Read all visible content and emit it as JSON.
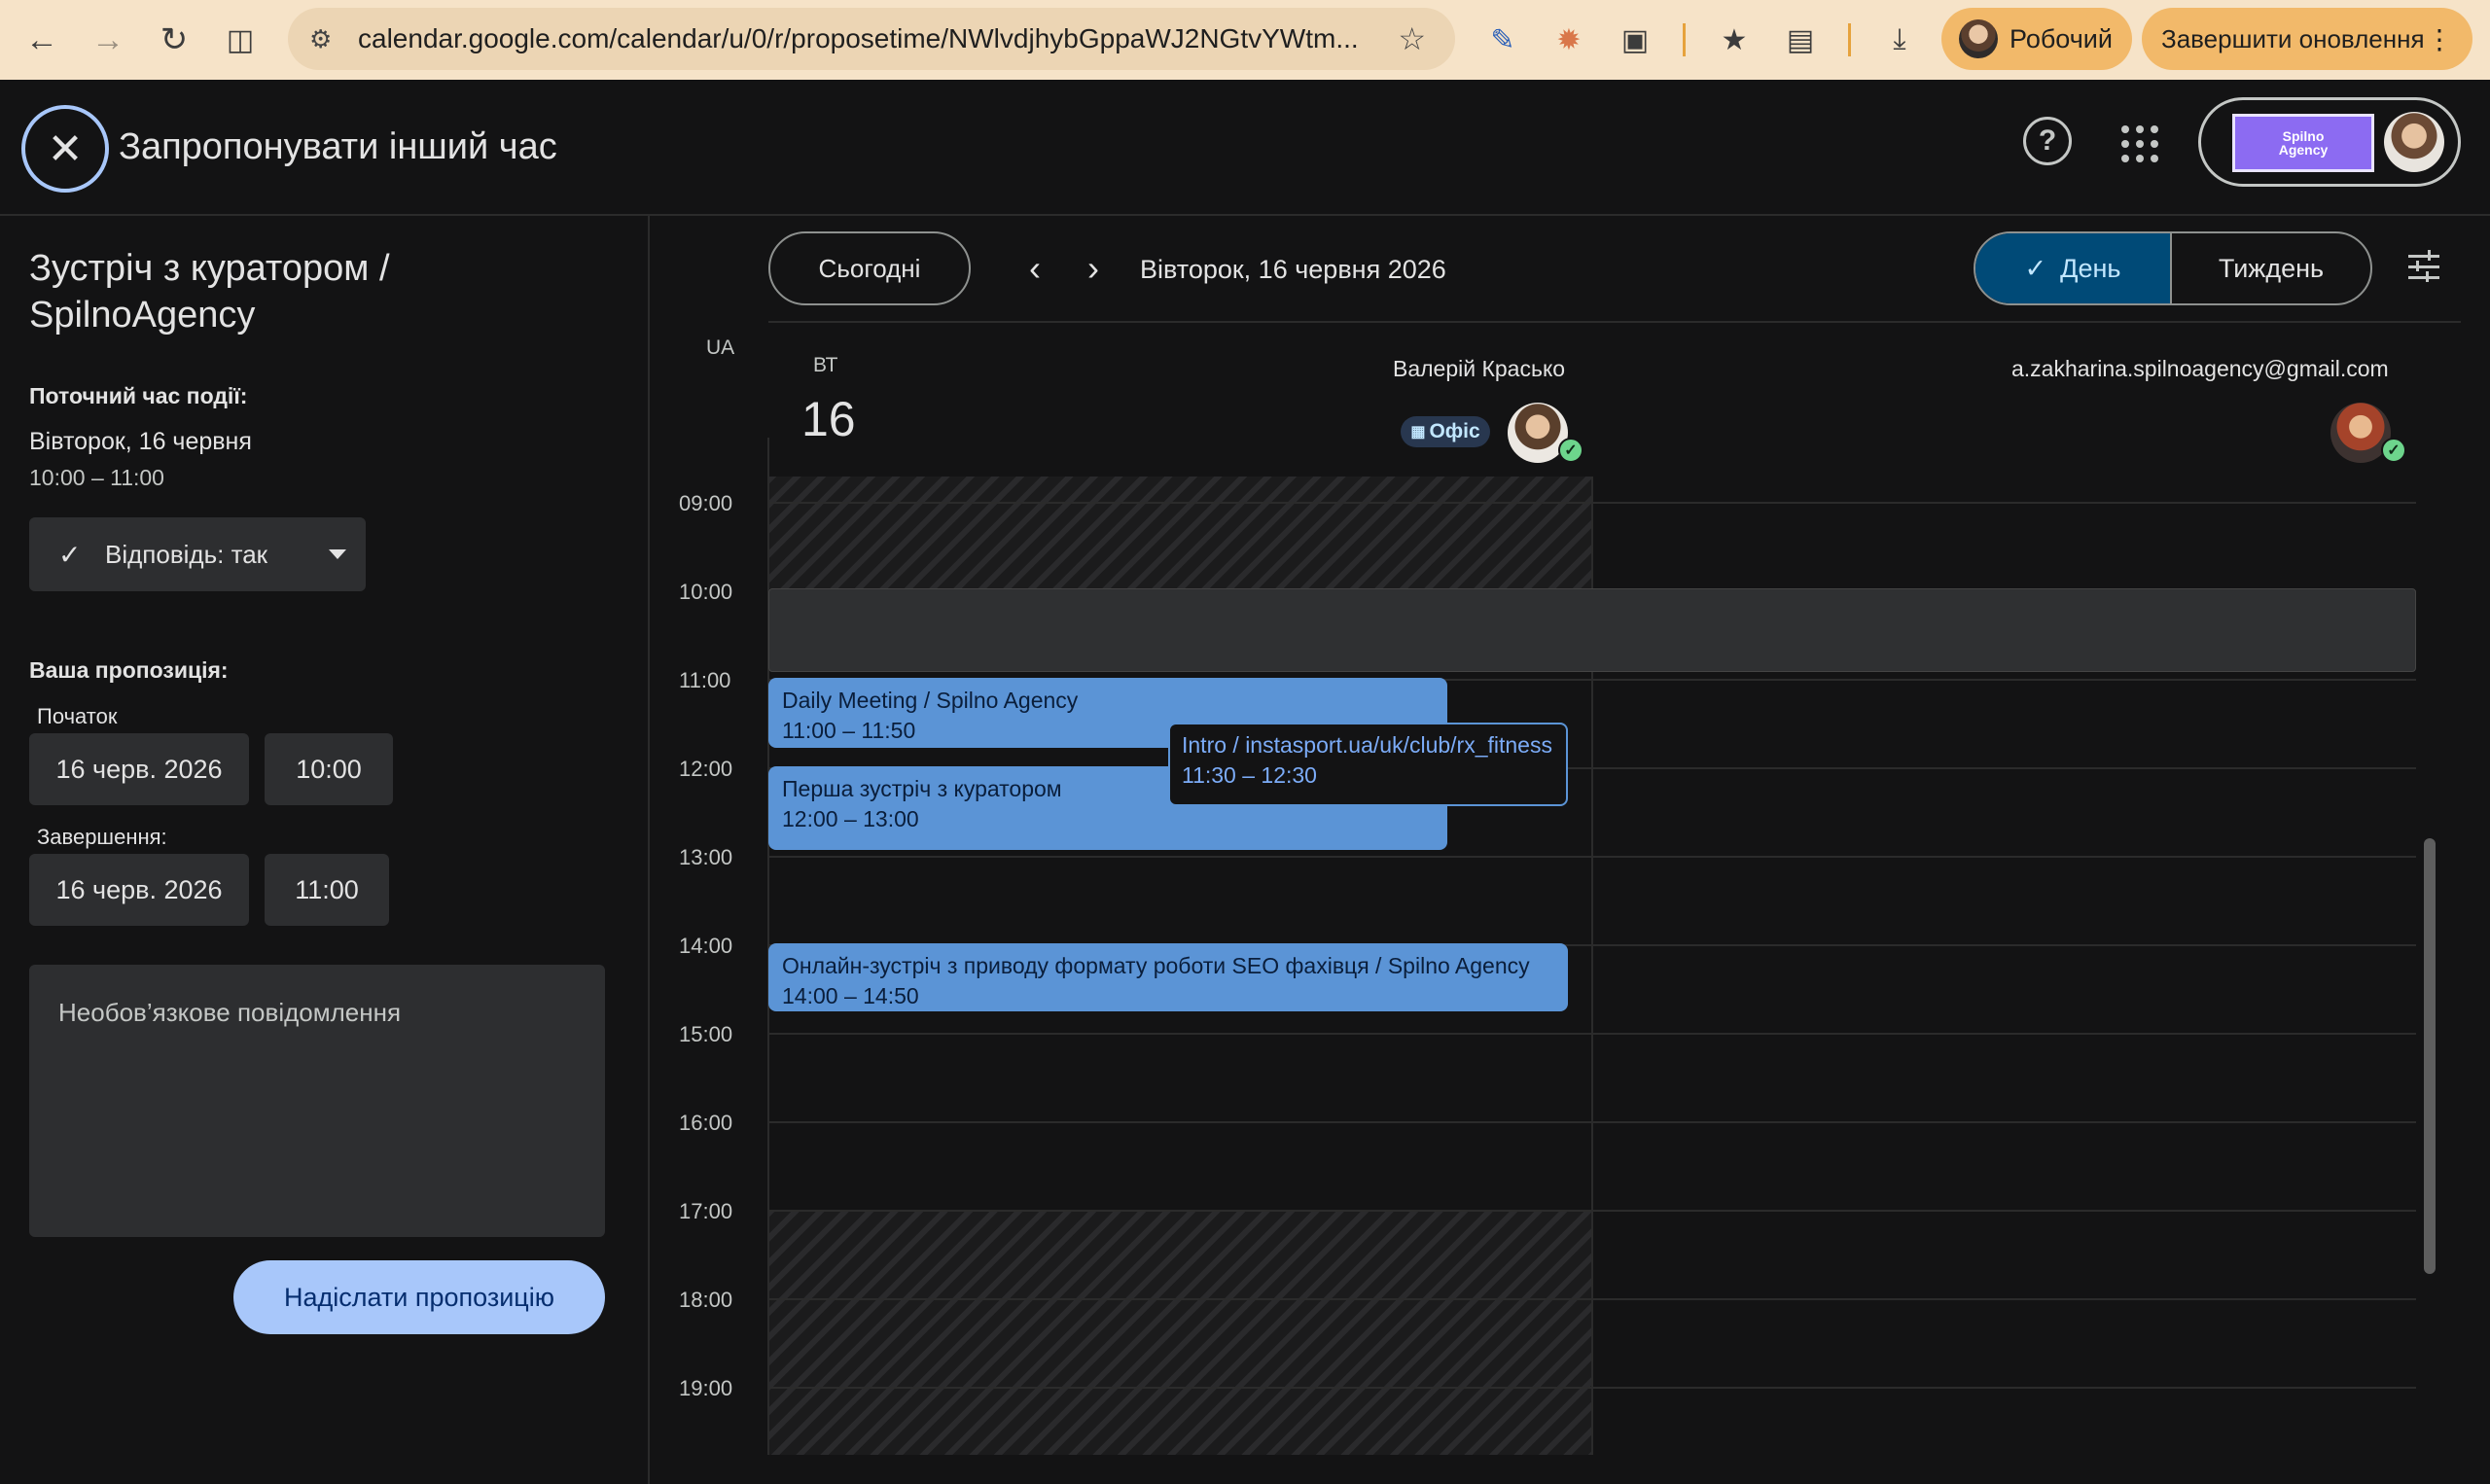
{
  "browser": {
    "url": "calendar.google.com/calendar/u/0/r/proposetime/NWlvdjhybGppaWJ2NGtvYWtm...",
    "profile_label": "Робочий",
    "update_label": "Завершити оновлення"
  },
  "header": {
    "title": "Запропонувати інший час"
  },
  "account": {
    "brand_line1": "Spilno",
    "brand_line2": "Agency"
  },
  "event": {
    "title": "Зустріч з куратором / SpilnoAgency",
    "current_label": "Поточний час події:",
    "current_date": "Вівторок, 16 червня",
    "current_time": "10:00 – 11:00",
    "rsvp_label": "Відповідь: так"
  },
  "proposal": {
    "heading": "Ваша пропозиція:",
    "start_label": "Початок",
    "start_date": "16 черв. 2026",
    "start_time": "10:00",
    "end_label": "Завершення:",
    "end_date": "16 черв. 2026",
    "end_time": "11:00",
    "message_placeholder": "Необов’язкове повідомлення",
    "send_label": "Надіслати пропозицію"
  },
  "toolbar": {
    "today_label": "Сьогодні",
    "date_heading": "Вівторок, 16 червня 2026",
    "view_day": "День",
    "view_week": "Тиждень"
  },
  "grid": {
    "timezone": "UA",
    "dow": "ВТ",
    "day_number": "16",
    "hours": [
      "09:00",
      "10:00",
      "11:00",
      "12:00",
      "13:00",
      "14:00",
      "15:00",
      "16:00",
      "17:00",
      "18:00",
      "19:00"
    ]
  },
  "people": [
    {
      "name": "Валерій Красько",
      "badge": "Офіс"
    },
    {
      "name": "a.zakharina.spilnoagency@gmail.com"
    }
  ],
  "events": [
    {
      "title": "Daily Meeting / Spilno Agency",
      "time": "11:00 – 11:50"
    },
    {
      "title": "Перша зустріч з куратором",
      "time": "12:00 – 13:00"
    },
    {
      "title": "Intro / instasport.ua/uk/club/rx_fitness",
      "time": "11:30 – 12:30"
    },
    {
      "title": "Онлайн-зустріч з приводу формату роботи SEO фахівця / Spilno Agency",
      "time": "14:00 – 14:50"
    }
  ]
}
